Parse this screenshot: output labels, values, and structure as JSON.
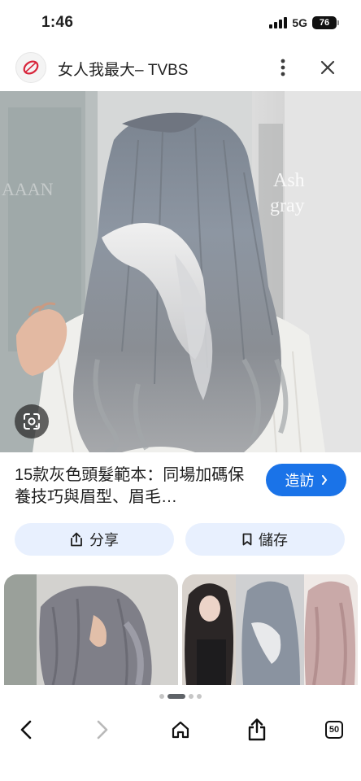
{
  "status_bar": {
    "time": "1:46",
    "network": "5G",
    "battery": "76"
  },
  "header": {
    "site_title": "女人我最大– TVBS",
    "logo_icon": "tvbs-logo-icon",
    "menu_icon": "more-vert-icon",
    "close_icon": "close-icon"
  },
  "image": {
    "watermark_line1": "Ash",
    "watermark_line2": "gray",
    "background_sign": "AAAN",
    "lens_icon": "google-lens-icon"
  },
  "result": {
    "title": "15款灰色頭髮範本：同場加碼保養技巧與眉型、眉毛…",
    "visit_label": "造訪",
    "share_label": "分享",
    "save_label": "儲存"
  },
  "pager": {
    "total": 4,
    "active": 1
  },
  "toolbar": {
    "tabs_count": "50",
    "icons": [
      "back-arrow-icon",
      "forward-arrow-icon",
      "home-icon",
      "share-icon",
      "tabs-icon"
    ]
  },
  "colors": {
    "accent": "#1a73e8",
    "chip_bg": "#e8f0fe",
    "text": "#1f1f1f"
  }
}
